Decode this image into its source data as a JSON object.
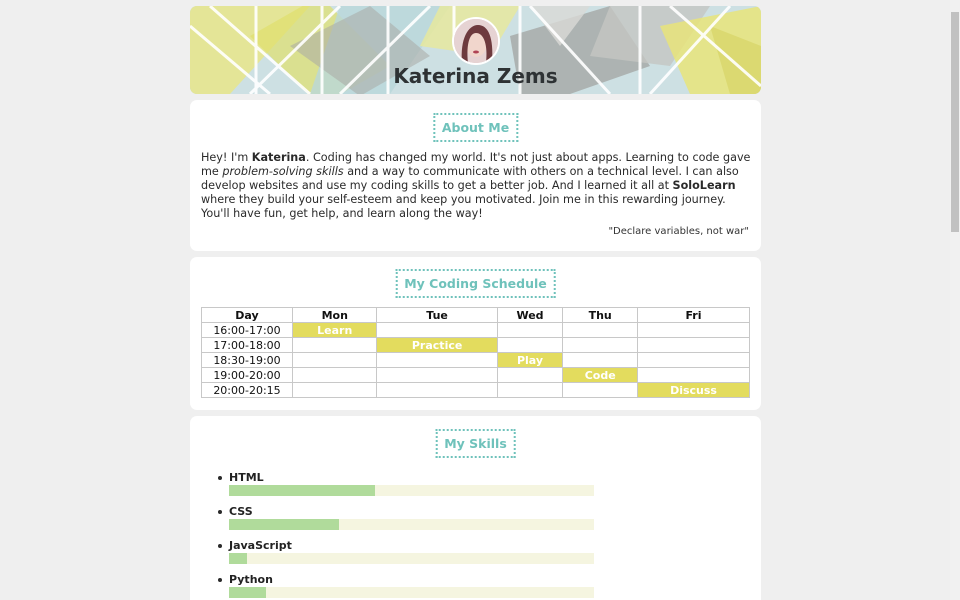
{
  "header": {
    "name": "Katerina Zems"
  },
  "about": {
    "title": "About Me",
    "parts": {
      "p1": "Hey! I'm ",
      "name": "Katerina",
      "p2": ". Coding has changed my world. It's not just about apps. Learning to code gave me ",
      "italic": "problem-solving skills",
      "p3": " and a way to communicate with others on a technical level. I can also develop websites and use my coding skills to get a better job. And I learned it all at ",
      "brand": "SoloLearn",
      "p4": " where they build your self-esteem and keep you motivated. Join me in this rewarding journey. You'll have fun, get help, and learn along the way!"
    },
    "quote": "\"Declare variables, not war\""
  },
  "schedule": {
    "title": "My Coding Schedule",
    "header_day": "Day",
    "days": [
      "Mon",
      "Tue",
      "Wed",
      "Thu",
      "Fri"
    ],
    "rows": [
      {
        "time": "16:00-17:00",
        "cells": [
          "Learn",
          "",
          "",
          "",
          ""
        ]
      },
      {
        "time": "17:00-18:00",
        "cells": [
          "",
          "Practice",
          "",
          "",
          ""
        ]
      },
      {
        "time": "18:30-19:00",
        "cells": [
          "",
          "",
          "Play",
          "",
          ""
        ]
      },
      {
        "time": "19:00-20:00",
        "cells": [
          "",
          "",
          "",
          "Code",
          ""
        ]
      },
      {
        "time": "20:00-20:15",
        "cells": [
          "",
          "",
          "",
          "",
          "Discuss"
        ]
      }
    ]
  },
  "skills": {
    "title": "My Skills",
    "items": [
      {
        "name": "HTML",
        "level": 0.4
      },
      {
        "name": "CSS",
        "level": 0.3
      },
      {
        "name": "JavaScript",
        "level": 0.05
      },
      {
        "name": "Python",
        "level": 0.1
      }
    ]
  },
  "colors": {
    "accent": "#6fc2bb",
    "activity": "#e3dc5e",
    "skill_fill": "#b0db9b",
    "skill_track": "#f5f5e0"
  },
  "icons": {
    "avatar": "profile-photo"
  }
}
